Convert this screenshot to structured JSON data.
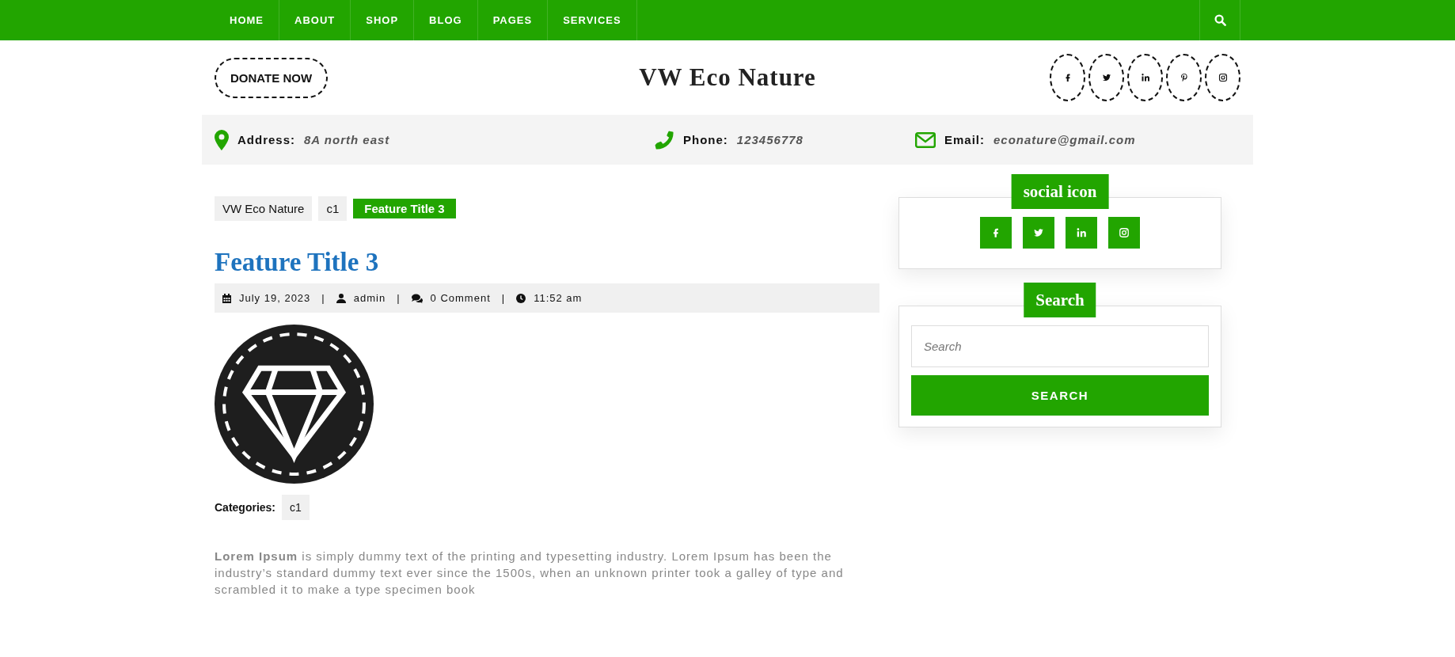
{
  "nav": {
    "items": [
      {
        "label": "HOME"
      },
      {
        "label": "ABOUT"
      },
      {
        "label": "SHOP"
      },
      {
        "label": "BLOG"
      },
      {
        "label": "PAGES"
      },
      {
        "label": "SERVICES"
      }
    ]
  },
  "header": {
    "donate_button": "DONATE NOW",
    "site_title": "VW Eco Nature",
    "social": [
      {
        "kind": "facebook"
      },
      {
        "kind": "twitter"
      },
      {
        "kind": "linkedin"
      },
      {
        "kind": "pinterest"
      },
      {
        "kind": "instagram"
      }
    ]
  },
  "contact": [
    {
      "kind": "address",
      "label": "Address:",
      "value": "8A north east"
    },
    {
      "kind": "phone",
      "label": "Phone:",
      "value": "123456778"
    },
    {
      "kind": "email",
      "label": "Email:",
      "value": "econature@gmail.com"
    }
  ],
  "breadcrumb": [
    {
      "label": "VW Eco Nature",
      "selected": false
    },
    {
      "label": "c1",
      "selected": false
    },
    {
      "label": "Feature Title 3",
      "selected": true
    }
  ],
  "post": {
    "title": "Feature Title 3",
    "meta": [
      {
        "kind": "date",
        "text": "July 19, 2023"
      },
      {
        "kind": "author",
        "text": "admin"
      },
      {
        "kind": "comments",
        "text": "0 Comment"
      },
      {
        "kind": "time",
        "text": "11:52 am"
      }
    ],
    "meta_separator": "|",
    "categories_label": "Categories:",
    "categories": [
      "c1"
    ],
    "body": "**Lorem Ipsum** is simply dummy text of the printing and typesetting industry. Lorem Ipsum has been the industry’s standard dummy text ever since the 1500s, when an unknown printer took a galley of type and scrambled it to make a type specimen book"
  },
  "sidebar": {
    "social_widget": {
      "title": "social icon",
      "icons": [
        {
          "kind": "facebook"
        },
        {
          "kind": "twitter"
        },
        {
          "kind": "linkedin"
        },
        {
          "kind": "instagram"
        }
      ]
    },
    "search_widget": {
      "title": "Search",
      "placeholder": "Search",
      "button": "SEARCH"
    }
  }
}
